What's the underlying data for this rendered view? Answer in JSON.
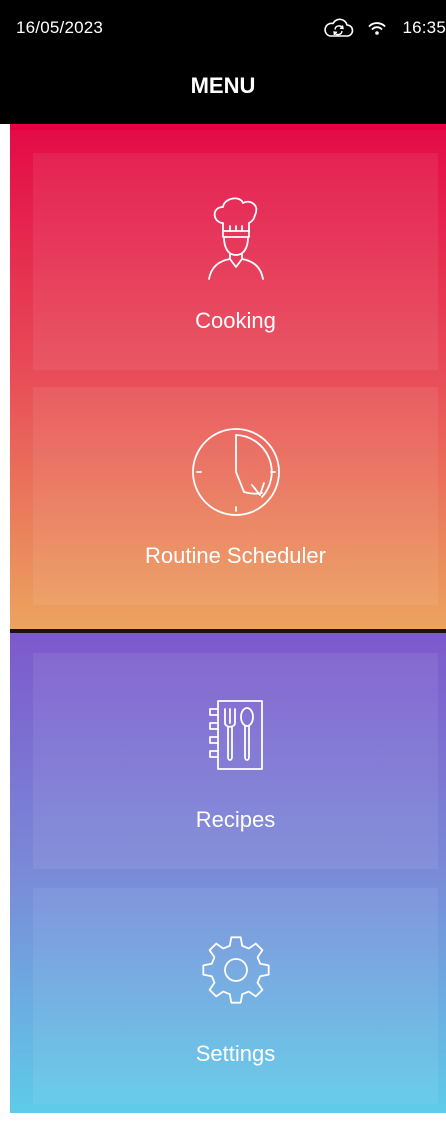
{
  "status_bar": {
    "date": "16/05/2023",
    "time": "16:35",
    "icons": [
      "cloud-sync-icon",
      "wifi-icon"
    ]
  },
  "header": {
    "title": "MENU"
  },
  "menu": {
    "items": [
      {
        "label": "Cooking",
        "icon": "chef-icon"
      },
      {
        "label": "Routine Scheduler",
        "icon": "clock-icon"
      },
      {
        "label": "Recipes",
        "icon": "recipe-book-icon"
      },
      {
        "label": "Settings",
        "icon": "gear-icon"
      }
    ]
  },
  "colors": {
    "warm_gradient": [
      "#e40b47",
      "#e84e58",
      "#eca45e"
    ],
    "cool_gradient": [
      "#7d59cc",
      "#7a8ad8",
      "#5ecbe9"
    ],
    "header_background": "#000000",
    "text": "#ffffff"
  }
}
